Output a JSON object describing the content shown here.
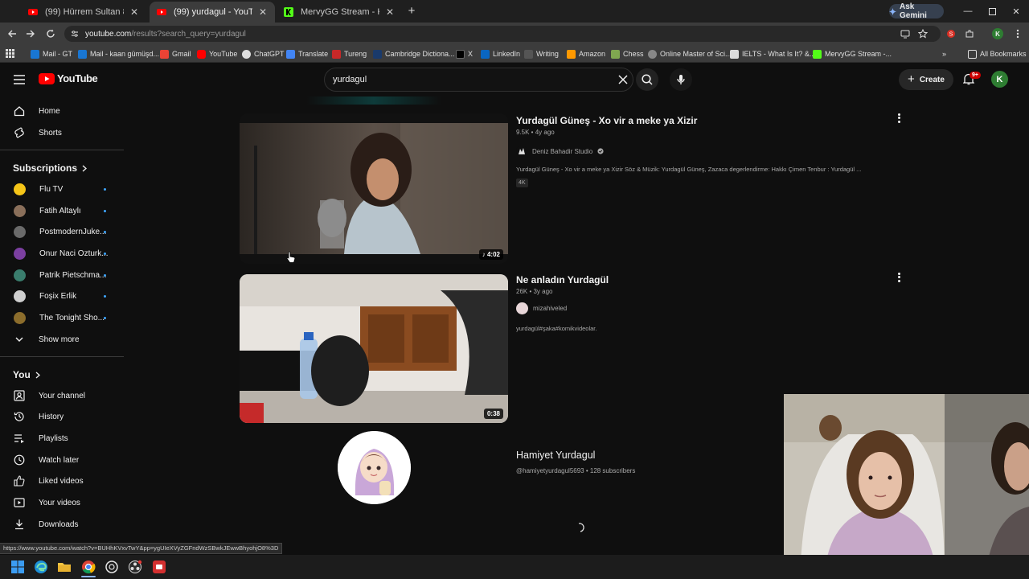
{
  "browser": {
    "tabs": [
      {
        "title": "(99) Hürrem Sultan 8. Bölüm (Fi",
        "active": false
      },
      {
        "title": "(99) yurdagul - YouTube",
        "active": true
      },
      {
        "title": "MervyGG Stream - Kick Dashbo",
        "active": false
      }
    ],
    "new_tab_label": "+",
    "ask_gemini": "Ask Gemini",
    "url_host": "youtube.com",
    "url_path": "/results?search_query=yurdagul",
    "bookmarks": [
      "Mail - GT",
      "Mail - kaan gümüşd...",
      "Gmail",
      "YouTube",
      "ChatGPT",
      "Translate",
      "Tureng",
      "Cambridge Dictiona...",
      "X",
      "LinkedIn",
      "Writing",
      "Amazon",
      "Chess",
      "Online Master of Sci...",
      "IELTS - What Is It? &...",
      "MervyGG Stream -..."
    ],
    "all_bookmarks": "All Bookmarks",
    "profile_initial": "K",
    "status_url": "https://www.youtube.com/watch?v=BUHhKVxvTwY&pp=ygUIeXVyZGFndWzSBwkJEwwBhyohjO8%3D"
  },
  "youtube": {
    "logo_text": "YouTube",
    "search_value": "yurdagul",
    "create_label": "Create",
    "notif_badge": "9+",
    "avatar_initial": "K",
    "sidebar": {
      "top": [
        {
          "label": "Home",
          "icon": "home-icon"
        },
        {
          "label": "Shorts",
          "icon": "shorts-icon"
        }
      ],
      "subscriptions_header": "Subscriptions",
      "subscriptions": [
        {
          "label": "Flu TV",
          "color": "#f5c518"
        },
        {
          "label": "Fatih Altaylı",
          "color": "#8a6f5a"
        },
        {
          "label": "PostmodernJuke...",
          "color": "#6a6a6a"
        },
        {
          "label": "Onur Naci Ozturk...",
          "color": "#7b3fa0"
        },
        {
          "label": "Patrik Pietschma...",
          "color": "#3a7d6d"
        },
        {
          "label": "Foşix Erlik",
          "color": "#cfcfcf"
        },
        {
          "label": "The Tonight Sho...",
          "color": "#8c6d2c"
        }
      ],
      "show_more": "Show more",
      "you_header": "You",
      "you": [
        {
          "label": "Your channel",
          "icon": "your-channel-icon"
        },
        {
          "label": "History",
          "icon": "history-icon"
        },
        {
          "label": "Playlists",
          "icon": "playlists-icon"
        },
        {
          "label": "Watch later",
          "icon": "watch-later-icon"
        },
        {
          "label": "Liked videos",
          "icon": "liked-videos-icon"
        },
        {
          "label": "Your videos",
          "icon": "your-videos-icon"
        },
        {
          "label": "Downloads",
          "icon": "downloads-icon"
        }
      ]
    },
    "results": [
      {
        "title": "Yurdagül Güneş - Xo vir a meke ya Xizir",
        "meta": "9.5K • 4y ago",
        "channel": "Deniz Bahadir Studio",
        "description": "Yurdagül Güneş - Xo vir a meke ya Xizir Söz & Müzik: Yurdagül Güneş, Zazaca degerlendirme: Hakkı Çimen Tenbur : Yurdagül ...",
        "badge": "4K",
        "duration": "4:02"
      },
      {
        "title": "Ne anladın Yurdagül",
        "meta": "26K • 3y ago",
        "channel": "mizahiveled",
        "description": "yurdagül#şaka#komikvideolar.",
        "duration": "0:38"
      }
    ],
    "channel_result": {
      "name": "Hamiyet Yurdagul",
      "meta": "@hamiyetyurdagul5693 • 128 subscribers"
    }
  }
}
